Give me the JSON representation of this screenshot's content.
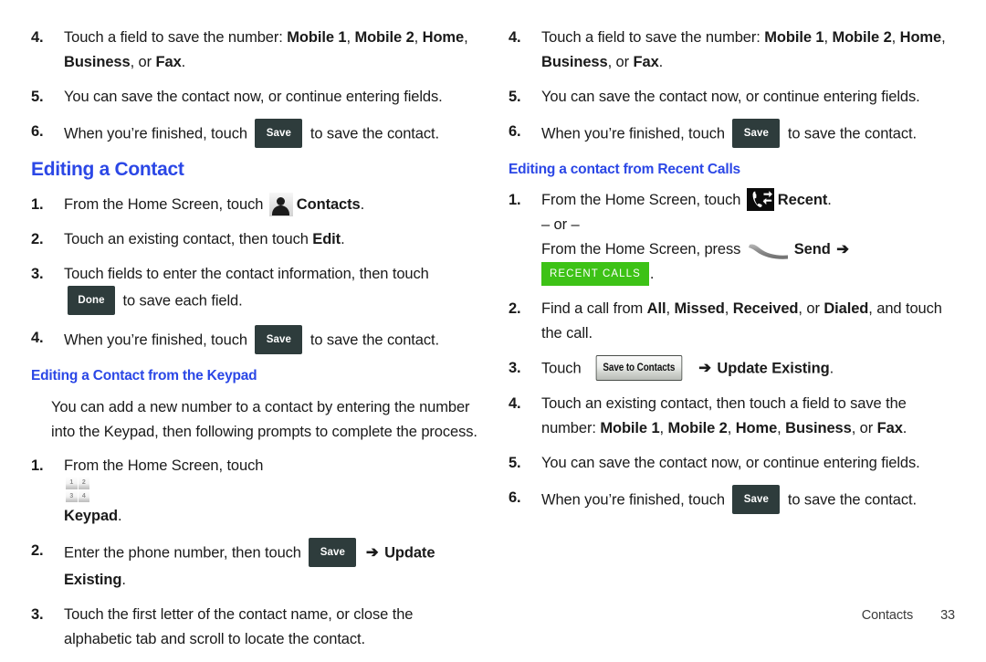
{
  "colors": {
    "heading_blue": "#2b47e6",
    "dark_button": "#2e3c3c",
    "green_tab": "#3dc216",
    "text": "#1a1a1a"
  },
  "left_column": {
    "steps_top": [
      {
        "num": "4.",
        "parts": [
          {
            "t": "Touch a field to save the number: ",
            "b": false
          },
          {
            "t": "Mobile 1",
            "b": true
          },
          {
            "t": ", ",
            "b": false
          },
          {
            "t": "Mobile 2",
            "b": true
          },
          {
            "t": ", ",
            "b": false
          },
          {
            "t": "Home",
            "b": true
          },
          {
            "t": ", ",
            "b": false
          },
          {
            "t": "Business",
            "b": true
          },
          {
            "t": ", or ",
            "b": false
          },
          {
            "t": "Fax",
            "b": true
          },
          {
            "t": ".",
            "b": false
          }
        ]
      },
      {
        "num": "5.",
        "parts": [
          {
            "t": "You can save the contact now, or continue entering fields.",
            "b": false
          }
        ]
      },
      {
        "num": "6.",
        "parts": [
          {
            "t": "When you’re finished, touch ",
            "b": false
          },
          {
            "widget": "save-button",
            "label": "Save"
          },
          {
            "t": " to save the contact.",
            "b": false
          }
        ]
      }
    ],
    "heading_main": "Editing a Contact",
    "steps_mid": [
      {
        "num": "1.",
        "parts": [
          {
            "t": "From the Home Screen, touch ",
            "b": false
          },
          {
            "widget": "contacts-icon"
          },
          {
            "t": "Contacts",
            "b": true
          },
          {
            "t": ".",
            "b": false
          }
        ]
      },
      {
        "num": "2.",
        "parts": [
          {
            "t": "Touch an existing contact, then touch ",
            "b": false
          },
          {
            "t": "Edit",
            "b": true
          },
          {
            "t": ".",
            "b": false
          }
        ]
      },
      {
        "num": "3.",
        "parts": [
          {
            "t": "Touch fields to enter the contact information, then touch ",
            "b": false
          },
          {
            "widget": "done-button",
            "label": "Done"
          },
          {
            "t": " to save each field.",
            "b": false
          }
        ]
      },
      {
        "num": "4.",
        "parts": [
          {
            "t": "When you’re finished, touch ",
            "b": false
          },
          {
            "widget": "save-button",
            "label": "Save"
          },
          {
            "t": " to save the contact.",
            "b": false
          }
        ]
      }
    ],
    "heading_sub": "Editing a Contact from the Keypad",
    "paragraph": "You can add a new number to a contact by entering the number into the Keypad, then following prompts to complete the process.",
    "steps_bottom": [
      {
        "num": "1.",
        "parts": [
          {
            "t": "From the Home Screen, touch ",
            "b": false
          },
          {
            "widget": "keypad-icon"
          },
          {
            "t": "Keypad",
            "b": true
          },
          {
            "t": ".",
            "b": false
          }
        ]
      },
      {
        "num": "2.",
        "parts": [
          {
            "t": "Enter the phone number, then touch ",
            "b": false
          },
          {
            "widget": "save-button",
            "label": "Save"
          },
          {
            "t": " ",
            "b": false
          },
          {
            "arrow": "➔"
          },
          {
            "t": " ",
            "b": false
          },
          {
            "t": "Update Existing",
            "b": true
          },
          {
            "t": ".",
            "b": false
          }
        ]
      },
      {
        "num": "3.",
        "parts": [
          {
            "t": "Touch the first letter of the contact name, or close the alphabetic tab and scroll to locate the contact.",
            "b": false
          }
        ]
      }
    ]
  },
  "right_column": {
    "steps_top": [
      {
        "num": "4.",
        "parts": [
          {
            "t": "Touch a field to save the number: ",
            "b": false
          },
          {
            "t": "Mobile 1",
            "b": true
          },
          {
            "t": ", ",
            "b": false
          },
          {
            "t": "Mobile 2",
            "b": true
          },
          {
            "t": ", ",
            "b": false
          },
          {
            "t": "Home",
            "b": true
          },
          {
            "t": ", ",
            "b": false
          },
          {
            "t": "Business",
            "b": true
          },
          {
            "t": ", or ",
            "b": false
          },
          {
            "t": "Fax",
            "b": true
          },
          {
            "t": ".",
            "b": false
          }
        ]
      },
      {
        "num": "5.",
        "parts": [
          {
            "t": "You can save the contact now, or continue entering fields.",
            "b": false
          }
        ]
      },
      {
        "num": "6.",
        "parts": [
          {
            "t": "When you’re finished, touch ",
            "b": false
          },
          {
            "widget": "save-button",
            "label": "Save"
          },
          {
            "t": " to save the contact.",
            "b": false
          }
        ]
      }
    ],
    "heading_sub": "Editing a contact from Recent Calls",
    "step_one": {
      "num": "1.",
      "line1": [
        {
          "t": "From the Home Screen, touch ",
          "b": false
        },
        {
          "widget": "recent-icon"
        },
        {
          "t": "Recent",
          "b": true
        },
        {
          "t": ".",
          "b": false
        }
      ],
      "or_text": "– or –",
      "line2": [
        {
          "t": "From the Home Screen, press ",
          "b": false
        },
        {
          "widget": "send-key"
        },
        {
          "t": "Send",
          "b": true
        },
        {
          "t": " ",
          "b": false
        },
        {
          "arrow": "➔"
        }
      ],
      "line3": [
        {
          "widget": "recent-calls-tab",
          "label": "RECENT CALLS"
        },
        {
          "t": ".",
          "b": false
        }
      ]
    },
    "steps_rest": [
      {
        "num": "2.",
        "parts": [
          {
            "t": "Find a call from ",
            "b": false
          },
          {
            "t": "All",
            "b": true
          },
          {
            "t": ", ",
            "b": false
          },
          {
            "t": "Missed",
            "b": true
          },
          {
            "t": ", ",
            "b": false
          },
          {
            "t": "Received",
            "b": true
          },
          {
            "t": ", or ",
            "b": false
          },
          {
            "t": "Dialed",
            "b": true
          },
          {
            "t": ", and touch the call.",
            "b": false
          }
        ]
      },
      {
        "num": "3.",
        "parts": [
          {
            "t": "Touch ",
            "b": false
          },
          {
            "widget": "save-to-contacts-button",
            "label": "Save to Contacts"
          },
          {
            "t": " ",
            "b": false
          },
          {
            "arrow": "➔"
          },
          {
            "t": " ",
            "b": false
          },
          {
            "t": "Update Existing",
            "b": true
          },
          {
            "t": ".",
            "b": false
          }
        ]
      },
      {
        "num": "4.",
        "parts": [
          {
            "t": "Touch an existing contact, then touch a field to save the number: ",
            "b": false
          },
          {
            "t": "Mobile 1",
            "b": true
          },
          {
            "t": ", ",
            "b": false
          },
          {
            "t": "Mobile 2",
            "b": true
          },
          {
            "t": ", ",
            "b": false
          },
          {
            "t": "Home",
            "b": true
          },
          {
            "t": ", ",
            "b": false
          },
          {
            "t": "Business",
            "b": true
          },
          {
            "t": ", or ",
            "b": false
          },
          {
            "t": "Fax",
            "b": true
          },
          {
            "t": ".",
            "b": false
          }
        ]
      },
      {
        "num": "5.",
        "parts": [
          {
            "t": "You can save the contact now, or continue entering fields.",
            "b": false
          }
        ]
      },
      {
        "num": "6.",
        "parts": [
          {
            "t": "When you’re finished, touch ",
            "b": false
          },
          {
            "widget": "save-button",
            "label": "Save"
          },
          {
            "t": " to save the contact.",
            "b": false
          }
        ]
      }
    ]
  },
  "keypad_icon_keys": [
    "1",
    "2",
    "3",
    "4"
  ],
  "footer": {
    "section": "Contacts",
    "page_number": "33"
  }
}
